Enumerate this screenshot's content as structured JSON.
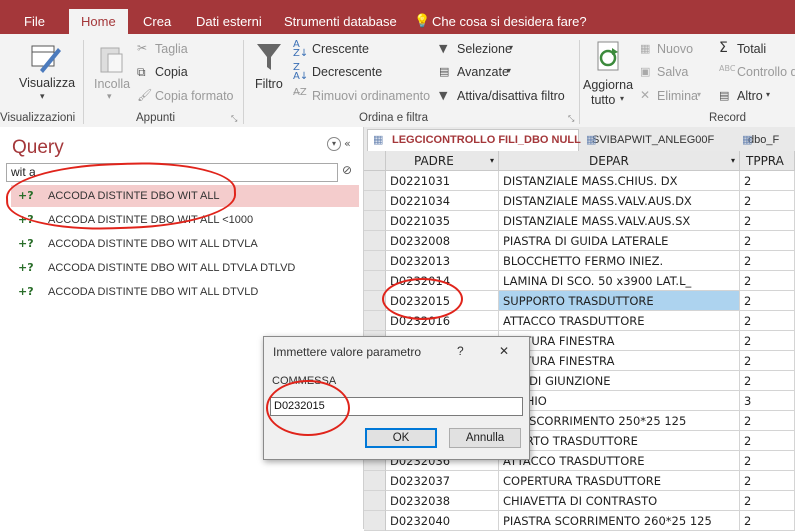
{
  "menu": {
    "tabs": [
      "File",
      "Home",
      "Crea",
      "Dati esterni",
      "Strumenti database"
    ],
    "tell_me": "Che cosa si desidera fare?"
  },
  "ribbon": {
    "visualizza": "Visualizza",
    "visualizza_group": "Visualizzazioni",
    "incolla": "Incolla",
    "taglia": "Taglia",
    "copia": "Copia",
    "copia_formato": "Copia formato",
    "appunti_group": "Appunti",
    "filtro": "Filtro",
    "crescente": "Crescente",
    "decrescente": "Decrescente",
    "rimuovi_ordinamento": "Rimuovi ordinamento",
    "selezione": "Selezione",
    "avanzate": "Avanzate",
    "attiva_filtro": "Attiva/disattiva filtro",
    "ordina_group": "Ordina e filtra",
    "aggiorna": "Aggiorna",
    "aggiorna2": "tutto",
    "nuovo": "Nuovo",
    "salva": "Salva",
    "elimina": "Elimina",
    "totali": "Totali",
    "controllo": "Controllo d",
    "altro": "Altro",
    "record_group": "Record"
  },
  "nav": {
    "title": "Query",
    "search_value": "wit a",
    "items": [
      "ACCODA DISTINTE DBO WIT ALL",
      "ACCODA DISTINTE DBO WIT ALL <1000",
      "ACCODA DISTINTE DBO WIT ALL DTVLA",
      "ACCODA DISTINTE DBO WIT ALL DTVLA DTLVD",
      "ACCODA DISTINTE DBO WIT ALL DTVLD"
    ]
  },
  "doc_tabs": [
    "LEGCICONTROLLO FILI_DBO NULL",
    "SVIBAPWIT_ANLEG00F",
    "dbo_F"
  ],
  "datasheet": {
    "columns": [
      "PADRE",
      "DEPAR",
      "TPPRA"
    ],
    "rows": [
      [
        "D0221031",
        "DISTANZIALE MASS.CHIUS. DX",
        "2"
      ],
      [
        "D0221034",
        "DISTANZIALE MASS.VALV.AUS.DX",
        "2"
      ],
      [
        "D0221035",
        "DISTANZIALE MASS.VALV.AUS.SX",
        "2"
      ],
      [
        "D0232008",
        "PIASTRA DI GUIDA LATERALE",
        "2"
      ],
      [
        "D0232013",
        "BLOCCHETTO FERMO INIEZ.",
        "2"
      ],
      [
        "D0232014",
        "LAMINA DI SCO. 50 x3900 LAT.L_",
        "2"
      ],
      [
        "D0232015",
        "SUPPORTO TRASDUTTORE",
        "2"
      ],
      [
        "D0232016",
        "ATTACCO TRASDUTTORE",
        "2"
      ],
      [
        "",
        "PERTURA FINESTRA",
        "2"
      ],
      [
        "",
        "PERTURA FINESTRA",
        "2"
      ],
      [
        "",
        "TRA DI GIUNZIONE",
        "2"
      ],
      [
        "",
        "ERCHIO",
        "3"
      ],
      [
        "",
        "TRA SCORRIMENTO 250*25 125",
        "2"
      ],
      [
        "",
        "PPORTO TRASDUTTORE",
        "2"
      ],
      [
        "D0232036",
        "ATTACCO TRASDUTTORE",
        "2"
      ],
      [
        "D0232037",
        "COPERTURA TRASDUTTORE",
        "2"
      ],
      [
        "D0232038",
        "CHIAVETTA DI CONTRASTO",
        "2"
      ],
      [
        "D0232040",
        "PIASTRA SCORRIMENTO 260*25 125",
        "2"
      ]
    ]
  },
  "dialog": {
    "title": "Immettere valore parametro",
    "help": "?",
    "close": "✕",
    "label": "COMMESSA",
    "value": "D0232015",
    "ok": "OK",
    "cancel": "Annulla"
  }
}
